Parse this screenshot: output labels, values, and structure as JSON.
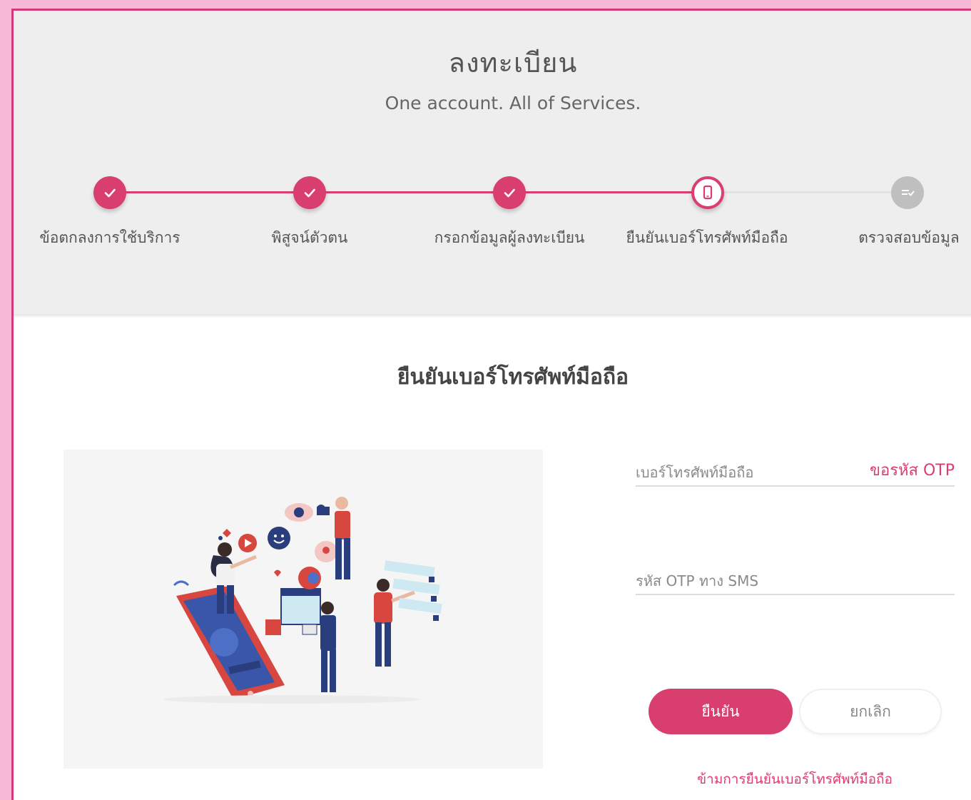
{
  "header": {
    "title": "ลงทะเบียน",
    "subtitle": "One account. All of Services."
  },
  "steps": [
    {
      "label": "ข้อตกลงการใช้บริการ",
      "status": "done",
      "icon": "check-icon"
    },
    {
      "label": "พิสูจน์ตัวตน",
      "status": "done",
      "icon": "check-icon"
    },
    {
      "label": "กรอกข้อมูลผู้ลงทะเบียน",
      "status": "done",
      "icon": "check-icon"
    },
    {
      "label": "ยืนยันเบอร์โทรศัพท์มือถือ",
      "status": "current",
      "icon": "phone-icon"
    },
    {
      "label": "ตรวจสอบข้อมูล",
      "status": "todo",
      "icon": "list-check-icon"
    }
  ],
  "section": {
    "title": "ยืนยันเบอร์โทรศัพท์มือถือ"
  },
  "form": {
    "phone_label": "เบอร์โทรศัพท์มือถือ",
    "request_otp": "ขอรหัส OTP",
    "otp_label": "รหัส OTP ทาง SMS",
    "confirm": "ยืนยัน",
    "cancel": "ยกเลิก",
    "skip": "ข้ามการยืนยันเบอร์โทรศัพท์มือถือ"
  },
  "colors": {
    "accent": "#d93f6e",
    "frame_border": "#d53a78",
    "header_bg": "#eeeeee",
    "pending": "#bfbfbf"
  }
}
